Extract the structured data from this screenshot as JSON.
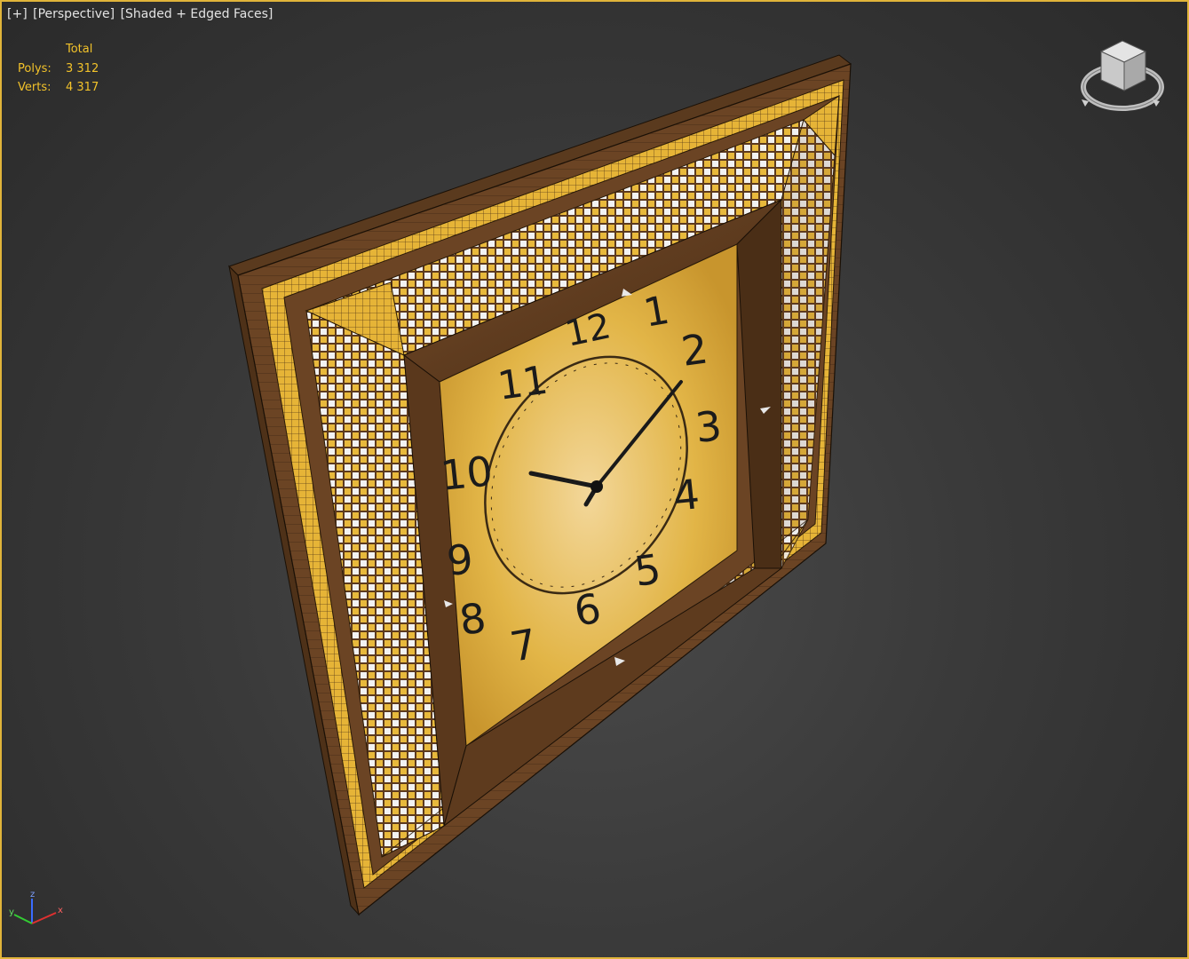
{
  "viewport": {
    "label_plus": "[+]",
    "label_view": "[Perspective]",
    "label_shading": "[Shaded + Edged Faces]",
    "border_color": "#e0b43a"
  },
  "stats": {
    "header": "Total",
    "polys_label": "Polys:",
    "polys_value": "3 312",
    "verts_label": "Verts:",
    "verts_value": "4 317",
    "color": "#f2c22a"
  },
  "clock": {
    "numerals": [
      "12",
      "1",
      "2",
      "3",
      "4",
      "5",
      "6",
      "7",
      "8",
      "9",
      "10",
      "11"
    ],
    "face_color": "#e4b332",
    "frame_wood": "#6b4424",
    "frame_gold": "#e6b437",
    "hour_hand": "hour-hand",
    "minute_hand": "minute-hand"
  },
  "viewcube": {
    "faces": [
      "top",
      "left",
      "front",
      "right"
    ],
    "icon": "viewcube-icon"
  },
  "axis_tripod": {
    "x": "x",
    "y": "y",
    "z": "z"
  }
}
